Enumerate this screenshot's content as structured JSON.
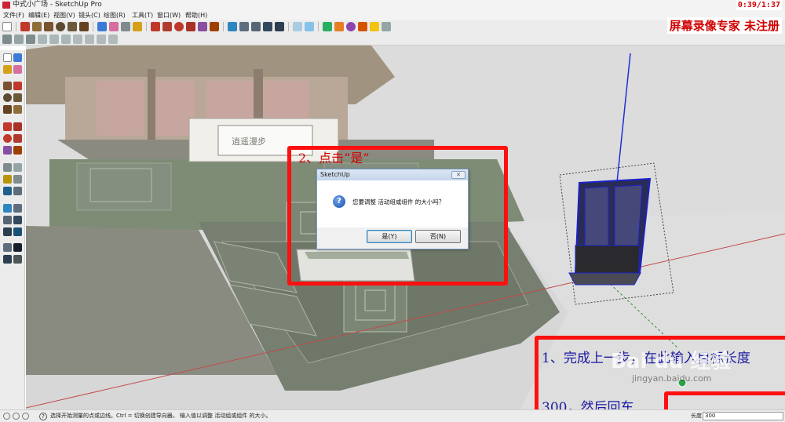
{
  "window": {
    "title": "中式小广场 - SketchUp Pro"
  },
  "recorder": {
    "time": "0:39/1:37",
    "brand": "屏幕录像专家  未注册"
  },
  "menu": [
    "文件(F)",
    "编辑(E)",
    "视图(V)",
    "镜头(C)",
    "绘图(R)",
    "工具(T)",
    "窗口(W)",
    "帮助(H)"
  ],
  "dialog": {
    "title": "SketchUp",
    "message": "您要调整 活动组或组件 的大小吗？",
    "yes_label": "是(Y)",
    "no_label": "否(N)"
  },
  "annotations": {
    "step2": "2、点击“是”",
    "step1_line1": "1、完成上一步，在此输入目标长度",
    "step1_line2": "300，然后回车"
  },
  "status": {
    "text": "选择开始测量的点或边线。Ctrl = 切换创建导向器。  输入值以调整 活动组或组件 的大小。",
    "measure_label": "长度",
    "measure_value": "300"
  },
  "watermark": {
    "brand": "Bai du 经验",
    "url": "jingyan.baidu.com"
  },
  "scene": {
    "plaque_text": "逍遥漫步"
  },
  "colors": {
    "accent_red": "#ff1010",
    "axis_blue": "#1f2fd8",
    "selection_blue": "#1a22c8"
  }
}
